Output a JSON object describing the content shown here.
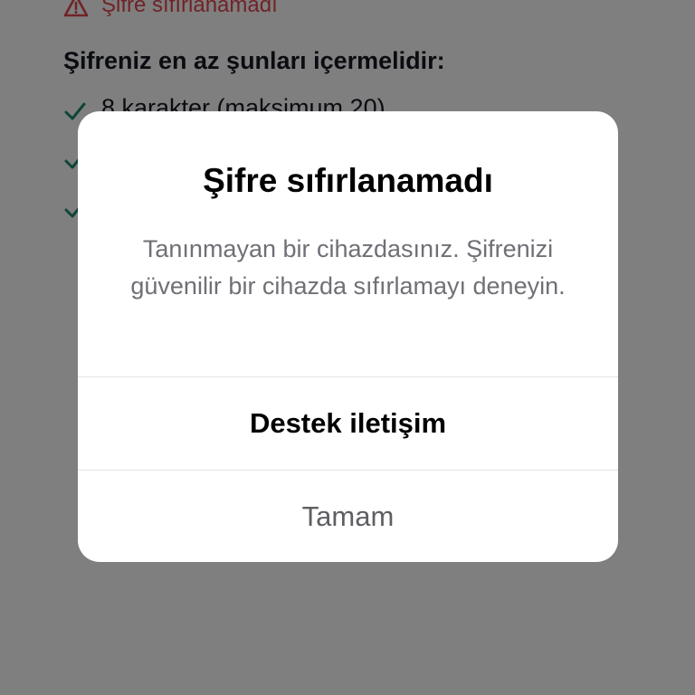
{
  "background": {
    "error_message": "Şifre sıfırlanamadı",
    "requirements_heading": "Şifreniz en az şunları içermelidir:",
    "requirements": [
      "8 karakter (maksimum 20)",
      "",
      ""
    ],
    "error_color": "#e0464e",
    "check_color": "#1f8a6e"
  },
  "dialog": {
    "title": "Şifre sıfırlanamadı",
    "message": "Tanınmayan bir cihazdasınız. Şifrenizi güvenilir bir cihazda sıfırlamayı deneyin.",
    "primary_button": "Destek iletişim",
    "secondary_button": "Tamam"
  },
  "icons": {
    "warning": "warning-triangle-icon",
    "check": "check-icon"
  }
}
